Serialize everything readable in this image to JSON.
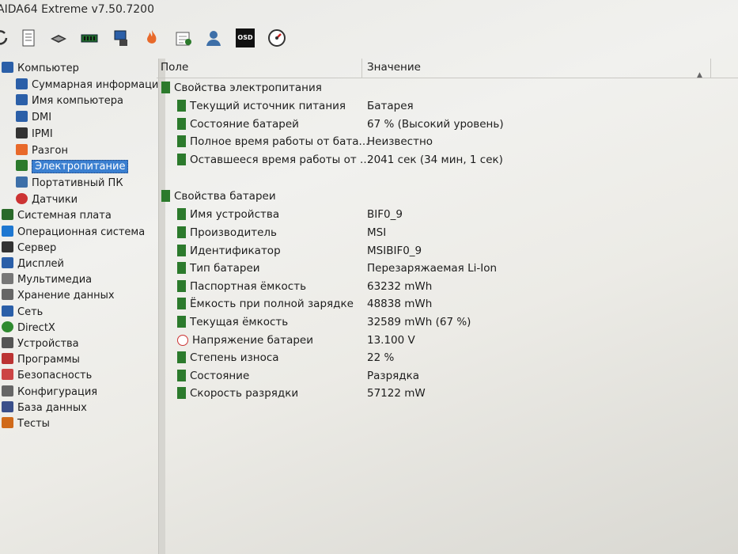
{
  "window": {
    "title": "AIDA64 Extreme v7.50.7200"
  },
  "toolbar": {
    "icons": [
      "refresh-icon",
      "report-icon",
      "motherboard-icon",
      "memory-icon",
      "computer-icon",
      "overclock-icon",
      "schedule-icon",
      "user-icon",
      "osd-icon",
      "gauge-icon"
    ],
    "osd_label": "OSD"
  },
  "sidebar": {
    "items": [
      {
        "label": "Компьютер",
        "level": 0,
        "icon": "computer-icon"
      },
      {
        "label": "Суммарная информация",
        "level": 1,
        "icon": "computer-icon"
      },
      {
        "label": "Имя компьютера",
        "level": 1,
        "icon": "computer-icon"
      },
      {
        "label": "DMI",
        "level": 1,
        "icon": "computer-icon"
      },
      {
        "label": "IPMI",
        "level": 1,
        "icon": "server-icon"
      },
      {
        "label": "Разгон",
        "level": 1,
        "icon": "flame-icon"
      },
      {
        "label": "Электропитание",
        "level": 1,
        "icon": "battery-icon",
        "selected": true
      },
      {
        "label": "Портативный ПК",
        "level": 1,
        "icon": "laptop-icon"
      },
      {
        "label": "Датчики",
        "level": 1,
        "icon": "gauge-icon"
      },
      {
        "label": "Системная плата",
        "level": 0,
        "icon": "motherboard-icon"
      },
      {
        "label": "Операционная система",
        "level": 0,
        "icon": "windows-icon"
      },
      {
        "label": "Сервер",
        "level": 0,
        "icon": "server-icon"
      },
      {
        "label": "Дисплей",
        "level": 0,
        "icon": "display-icon"
      },
      {
        "label": "Мультимедиа",
        "level": 0,
        "icon": "speaker-icon"
      },
      {
        "label": "Хранение данных",
        "level": 0,
        "icon": "storage-icon"
      },
      {
        "label": "Сеть",
        "level": 0,
        "icon": "network-icon"
      },
      {
        "label": "DirectX",
        "level": 0,
        "icon": "xbox-icon"
      },
      {
        "label": "Устройства",
        "level": 0,
        "icon": "device-icon"
      },
      {
        "label": "Программы",
        "level": 0,
        "icon": "programs-icon"
      },
      {
        "label": "Безопасность",
        "level": 0,
        "icon": "shield-icon"
      },
      {
        "label": "Конфигурация",
        "level": 0,
        "icon": "config-icon"
      },
      {
        "label": "База данных",
        "level": 0,
        "icon": "database-icon"
      },
      {
        "label": "Тесты",
        "level": 0,
        "icon": "tests-icon"
      }
    ]
  },
  "main": {
    "columns": {
      "field": "Поле",
      "value": "Значение"
    },
    "groups": [
      {
        "title": "Свойства электропитания",
        "rows": [
          {
            "field": "Текущий источник питания",
            "value": "Батарея"
          },
          {
            "field": "Состояние батарей",
            "value": "67 % (Высокий уровень)"
          },
          {
            "field": "Полное время работы от бата...",
            "value": "Неизвестно"
          },
          {
            "field": "Оставшееся время работы от ...",
            "value": "2041 сек (34 мин, 1 сек)"
          }
        ]
      },
      {
        "title": "Свойства батареи",
        "rows": [
          {
            "field": "Имя устройства",
            "value": "BIF0_9"
          },
          {
            "field": "Производитель",
            "value": "MSI"
          },
          {
            "field": "Идентификатор",
            "value": "MSIBIF0_9"
          },
          {
            "field": "Тип батареи",
            "value": "Перезаряжаемая Li-Ion"
          },
          {
            "field": "Паспортная ёмкость",
            "value": "63232 mWh"
          },
          {
            "field": "Ёмкость при полной зарядке",
            "value": "48838 mWh"
          },
          {
            "field": "Текущая ёмкость",
            "value": "32589 mWh  (67 %)"
          },
          {
            "field": "Напряжение батареи",
            "value": "13.100 V",
            "icon": "voltage-icon"
          },
          {
            "field": "Степень износа",
            "value": "22 %"
          },
          {
            "field": "Состояние",
            "value": "Разрядка"
          },
          {
            "field": "Скорость разрядки",
            "value": "57122 mW"
          }
        ]
      }
    ]
  }
}
